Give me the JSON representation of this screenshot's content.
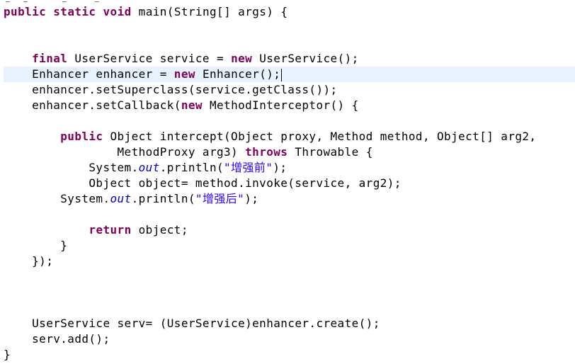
{
  "editor": {
    "lines": [
      [
        {
          "t": "kw",
          "v": "public"
        },
        {
          "t": "p",
          "v": " "
        },
        {
          "t": "kw",
          "v": "static"
        },
        {
          "t": "p",
          "v": " "
        },
        {
          "t": "kw",
          "v": "void"
        },
        {
          "t": "p",
          "v": " main(String[] args) {"
        }
      ],
      [],
      [],
      [
        {
          "t": "p",
          "v": "    "
        },
        {
          "t": "kw",
          "v": "final"
        },
        {
          "t": "p",
          "v": " UserService service = "
        },
        {
          "t": "kw",
          "v": "new"
        },
        {
          "t": "p",
          "v": " UserService();"
        }
      ],
      [
        {
          "t": "p",
          "v": "    Enhancer enhancer = "
        },
        {
          "t": "kw",
          "v": "new"
        },
        {
          "t": "p",
          "v": " Enhancer();"
        }
      ],
      [
        {
          "t": "p",
          "v": "    enhancer.setSuperclass(service.getClass());"
        }
      ],
      [
        {
          "t": "p",
          "v": "    enhancer.setCallback("
        },
        {
          "t": "kw",
          "v": "new"
        },
        {
          "t": "p",
          "v": " MethodInterceptor() {"
        }
      ],
      [],
      [
        {
          "t": "p",
          "v": "        "
        },
        {
          "t": "kw",
          "v": "public"
        },
        {
          "t": "p",
          "v": " Object intercept(Object proxy, Method method, Object[] arg2,"
        }
      ],
      [
        {
          "t": "p",
          "v": "                MethodProxy arg3) "
        },
        {
          "t": "kw",
          "v": "throws"
        },
        {
          "t": "p",
          "v": " Throwable {"
        }
      ],
      [
        {
          "t": "p",
          "v": "            System."
        },
        {
          "t": "fld",
          "v": "out"
        },
        {
          "t": "p",
          "v": ".println("
        },
        {
          "t": "str",
          "v": "\"增强前\""
        },
        {
          "t": "p",
          "v": ");"
        }
      ],
      [
        {
          "t": "p",
          "v": "            Object object= method.invoke(service, arg2);"
        }
      ],
      [
        {
          "t": "p",
          "v": "        System."
        },
        {
          "t": "fld",
          "v": "out"
        },
        {
          "t": "p",
          "v": ".println("
        },
        {
          "t": "str",
          "v": "\"增强后\""
        },
        {
          "t": "p",
          "v": ");"
        }
      ],
      [],
      [
        {
          "t": "p",
          "v": "            "
        },
        {
          "t": "kw",
          "v": "return"
        },
        {
          "t": "p",
          "v": " object;"
        }
      ],
      [
        {
          "t": "p",
          "v": "        }"
        }
      ],
      [
        {
          "t": "p",
          "v": "    });"
        }
      ],
      [],
      [],
      [],
      [
        {
          "t": "p",
          "v": "    UserService serv= (UserService)enhancer.create();"
        }
      ],
      [
        {
          "t": "p",
          "v": "    serv.add();"
        }
      ],
      [
        {
          "t": "p",
          "v": "}"
        }
      ]
    ],
    "current_line": 5,
    "colors": {
      "keyword": "#7f0055",
      "field": "#0000c0",
      "string": "#2a00ff",
      "current_line_bg": "#e8f2fe",
      "text": "#000000"
    }
  }
}
